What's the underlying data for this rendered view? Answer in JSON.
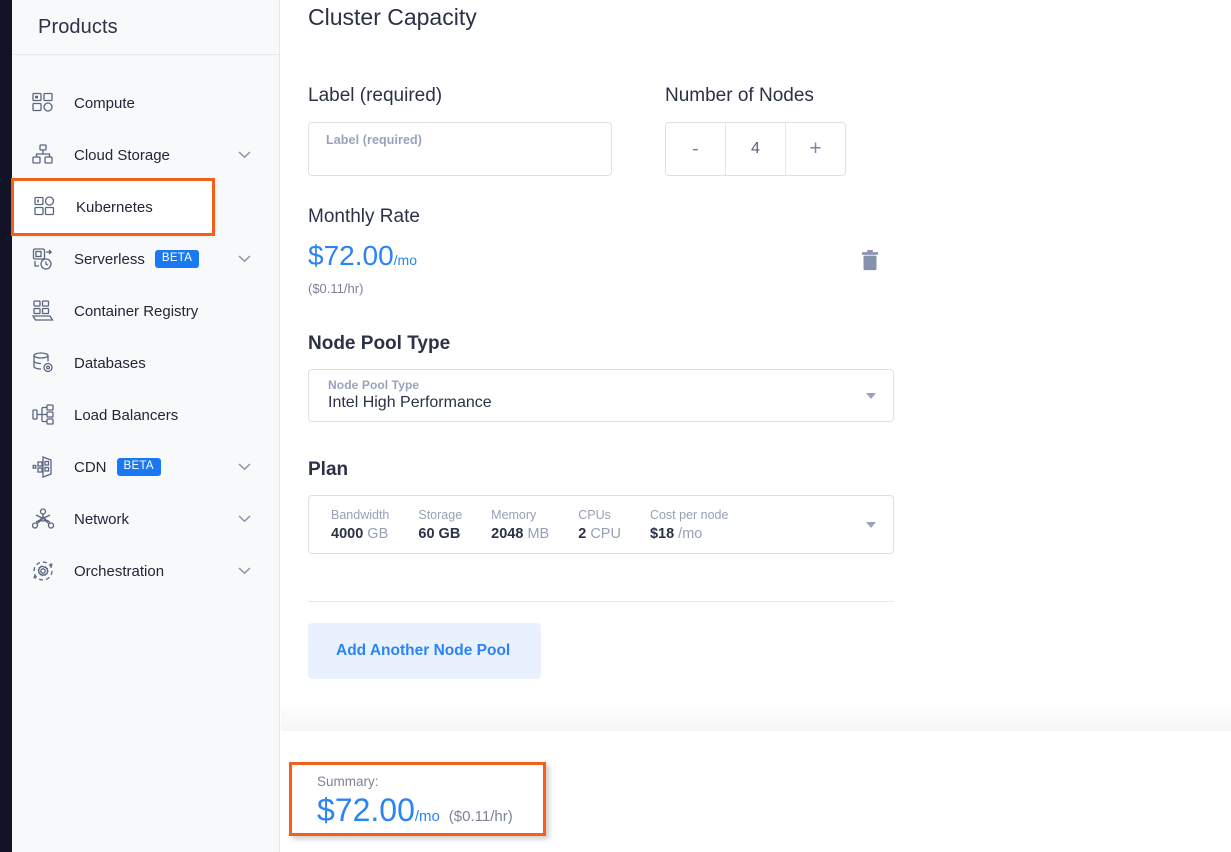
{
  "sidebar": {
    "title": "Products",
    "items": [
      {
        "label": "Compute",
        "icon": "compute-icon",
        "badge": null,
        "chevron": false,
        "highlighted": false
      },
      {
        "label": "Cloud Storage",
        "icon": "cloud-storage-icon",
        "badge": null,
        "chevron": true,
        "highlighted": false
      },
      {
        "label": "Kubernetes",
        "icon": "kubernetes-icon",
        "badge": null,
        "chevron": false,
        "highlighted": true
      },
      {
        "label": "Serverless",
        "icon": "serverless-icon",
        "badge": "BETA",
        "chevron": true,
        "highlighted": false
      },
      {
        "label": "Container Registry",
        "icon": "container-registry-icon",
        "badge": null,
        "chevron": false,
        "highlighted": false
      },
      {
        "label": "Databases",
        "icon": "databases-icon",
        "badge": null,
        "chevron": false,
        "highlighted": false
      },
      {
        "label": "Load Balancers",
        "icon": "load-balancers-icon",
        "badge": null,
        "chevron": false,
        "highlighted": false
      },
      {
        "label": "CDN",
        "icon": "cdn-icon",
        "badge": "BETA",
        "chevron": true,
        "highlighted": false
      },
      {
        "label": "Network",
        "icon": "network-icon",
        "badge": null,
        "chevron": true,
        "highlighted": false
      },
      {
        "label": "Orchestration",
        "icon": "orchestration-icon",
        "badge": null,
        "chevron": true,
        "highlighted": false
      }
    ]
  },
  "main": {
    "page_title": "Cluster Capacity",
    "label_field": {
      "heading": "Label (required)",
      "mini_label": "Label (required)",
      "value": "",
      "placeholder": "Label (required)"
    },
    "nodes_field": {
      "heading": "Number of Nodes",
      "decrement_label": "-",
      "value": "4",
      "increment_label": "+"
    },
    "monthly_rate": {
      "heading": "Monthly Rate",
      "price": "$72.00",
      "price_unit": "/mo",
      "hourly": "($0.11/hr)",
      "delete_icon": "trash-icon"
    },
    "node_pool_type": {
      "heading": "Node Pool Type",
      "mini_label": "Node Pool Type",
      "value": "Intel High Performance"
    },
    "plan": {
      "heading": "Plan",
      "columns": [
        {
          "label": "Cost per node",
          "value": "$18",
          "unit": "/mo",
          "unit_bold": false
        },
        {
          "label": "CPUs",
          "value": "2",
          "unit": "CPU",
          "unit_bold": false
        },
        {
          "label": "Memory",
          "value": "2048",
          "unit": "MB",
          "unit_bold": false
        },
        {
          "label": "Storage",
          "value": "60",
          "unit": "GB",
          "unit_bold": true
        },
        {
          "label": "Bandwidth",
          "value": "4000",
          "unit": "GB",
          "unit_bold": false
        }
      ]
    },
    "add_node_pool_label": "Add Another Node Pool"
  },
  "summary": {
    "label": "Summary:",
    "price": "$72.00",
    "price_unit": "/mo",
    "hourly": "($0.11/hr)"
  },
  "colors": {
    "accent_blue": "#2a84f5",
    "badge_blue": "#1a79f2",
    "highlight_orange": "#f4601a",
    "rail_dark": "#121326",
    "sidebar_bg": "#f8f9fb",
    "text_dark": "#2b3245",
    "text_muted": "#98a0b8"
  }
}
